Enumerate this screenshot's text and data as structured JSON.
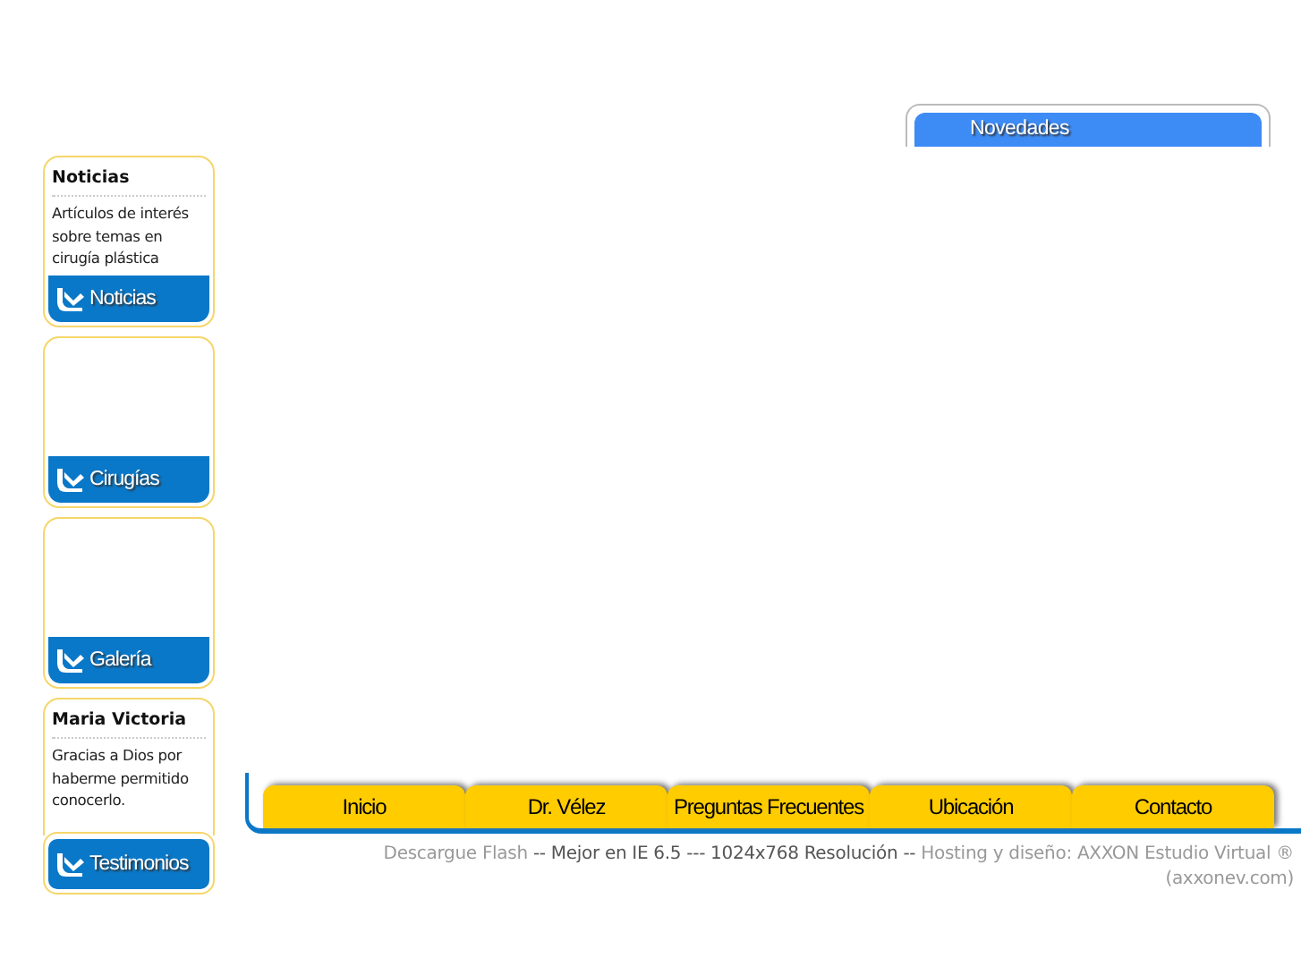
{
  "sidebar": [
    {
      "kind": "text",
      "title": "Noticias",
      "body": "Artículos de interés sobre temas en cirugía plástica",
      "button": "Noticias"
    },
    {
      "kind": "empty",
      "button": "Cirugías"
    },
    {
      "kind": "empty",
      "button": "Galería"
    },
    {
      "kind": "detached",
      "title": "Maria Victoria",
      "body": "Gracias a Dios por haberme permitido conocerlo.",
      "button": "Testimonios"
    }
  ],
  "news_tab": {
    "label": "Novedades"
  },
  "nav": [
    "Inicio",
    "Dr. Vélez",
    "Preguntas Frecuentes",
    "Ubicación",
    "Contacto"
  ],
  "footer": [
    {
      "kind": "link",
      "text": "Descargue Flash"
    },
    {
      "kind": "plain",
      "text": "-- Mejor en IE 6.5 --- 1024x768 Resolución --"
    },
    {
      "kind": "link",
      "text": "Hosting y diseño: AXXON Estudio Virtual ®"
    },
    {
      "kind": "line",
      "text": "(axxonev.com)"
    }
  ]
}
